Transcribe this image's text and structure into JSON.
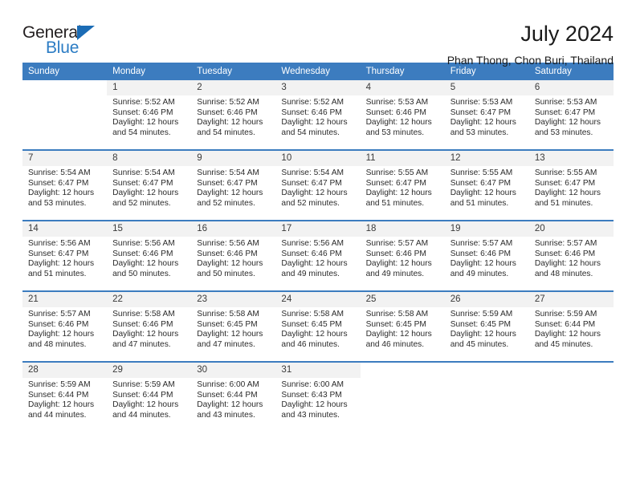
{
  "brand": {
    "name_part1": "General",
    "name_part2": "Blue",
    "triangle_color": "#1b6cb5",
    "blue_color": "#2b7cc4"
  },
  "header": {
    "title": "July 2024",
    "subtitle": "Phan Thong, Chon Buri, Thailand"
  },
  "theme": {
    "header_row_bg": "#3c7cbf",
    "daynum_bg": "#f2f2f2",
    "text_color": "#2b2b2b"
  },
  "calendar": {
    "weekday_headers": [
      "Sunday",
      "Monday",
      "Tuesday",
      "Wednesday",
      "Thursday",
      "Friday",
      "Saturday"
    ],
    "weeks": [
      [
        {
          "day": ""
        },
        {
          "day": "1",
          "sunrise": "Sunrise: 5:52 AM",
          "sunset": "Sunset: 6:46 PM",
          "daylight": "Daylight: 12 hours and 54 minutes."
        },
        {
          "day": "2",
          "sunrise": "Sunrise: 5:52 AM",
          "sunset": "Sunset: 6:46 PM",
          "daylight": "Daylight: 12 hours and 54 minutes."
        },
        {
          "day": "3",
          "sunrise": "Sunrise: 5:52 AM",
          "sunset": "Sunset: 6:46 PM",
          "daylight": "Daylight: 12 hours and 54 minutes."
        },
        {
          "day": "4",
          "sunrise": "Sunrise: 5:53 AM",
          "sunset": "Sunset: 6:46 PM",
          "daylight": "Daylight: 12 hours and 53 minutes."
        },
        {
          "day": "5",
          "sunrise": "Sunrise: 5:53 AM",
          "sunset": "Sunset: 6:47 PM",
          "daylight": "Daylight: 12 hours and 53 minutes."
        },
        {
          "day": "6",
          "sunrise": "Sunrise: 5:53 AM",
          "sunset": "Sunset: 6:47 PM",
          "daylight": "Daylight: 12 hours and 53 minutes."
        }
      ],
      [
        {
          "day": "7",
          "sunrise": "Sunrise: 5:54 AM",
          "sunset": "Sunset: 6:47 PM",
          "daylight": "Daylight: 12 hours and 53 minutes."
        },
        {
          "day": "8",
          "sunrise": "Sunrise: 5:54 AM",
          "sunset": "Sunset: 6:47 PM",
          "daylight": "Daylight: 12 hours and 52 minutes."
        },
        {
          "day": "9",
          "sunrise": "Sunrise: 5:54 AM",
          "sunset": "Sunset: 6:47 PM",
          "daylight": "Daylight: 12 hours and 52 minutes."
        },
        {
          "day": "10",
          "sunrise": "Sunrise: 5:54 AM",
          "sunset": "Sunset: 6:47 PM",
          "daylight": "Daylight: 12 hours and 52 minutes."
        },
        {
          "day": "11",
          "sunrise": "Sunrise: 5:55 AM",
          "sunset": "Sunset: 6:47 PM",
          "daylight": "Daylight: 12 hours and 51 minutes."
        },
        {
          "day": "12",
          "sunrise": "Sunrise: 5:55 AM",
          "sunset": "Sunset: 6:47 PM",
          "daylight": "Daylight: 12 hours and 51 minutes."
        },
        {
          "day": "13",
          "sunrise": "Sunrise: 5:55 AM",
          "sunset": "Sunset: 6:47 PM",
          "daylight": "Daylight: 12 hours and 51 minutes."
        }
      ],
      [
        {
          "day": "14",
          "sunrise": "Sunrise: 5:56 AM",
          "sunset": "Sunset: 6:47 PM",
          "daylight": "Daylight: 12 hours and 51 minutes."
        },
        {
          "day": "15",
          "sunrise": "Sunrise: 5:56 AM",
          "sunset": "Sunset: 6:46 PM",
          "daylight": "Daylight: 12 hours and 50 minutes."
        },
        {
          "day": "16",
          "sunrise": "Sunrise: 5:56 AM",
          "sunset": "Sunset: 6:46 PM",
          "daylight": "Daylight: 12 hours and 50 minutes."
        },
        {
          "day": "17",
          "sunrise": "Sunrise: 5:56 AM",
          "sunset": "Sunset: 6:46 PM",
          "daylight": "Daylight: 12 hours and 49 minutes."
        },
        {
          "day": "18",
          "sunrise": "Sunrise: 5:57 AM",
          "sunset": "Sunset: 6:46 PM",
          "daylight": "Daylight: 12 hours and 49 minutes."
        },
        {
          "day": "19",
          "sunrise": "Sunrise: 5:57 AM",
          "sunset": "Sunset: 6:46 PM",
          "daylight": "Daylight: 12 hours and 49 minutes."
        },
        {
          "day": "20",
          "sunrise": "Sunrise: 5:57 AM",
          "sunset": "Sunset: 6:46 PM",
          "daylight": "Daylight: 12 hours and 48 minutes."
        }
      ],
      [
        {
          "day": "21",
          "sunrise": "Sunrise: 5:57 AM",
          "sunset": "Sunset: 6:46 PM",
          "daylight": "Daylight: 12 hours and 48 minutes."
        },
        {
          "day": "22",
          "sunrise": "Sunrise: 5:58 AM",
          "sunset": "Sunset: 6:46 PM",
          "daylight": "Daylight: 12 hours and 47 minutes."
        },
        {
          "day": "23",
          "sunrise": "Sunrise: 5:58 AM",
          "sunset": "Sunset: 6:45 PM",
          "daylight": "Daylight: 12 hours and 47 minutes."
        },
        {
          "day": "24",
          "sunrise": "Sunrise: 5:58 AM",
          "sunset": "Sunset: 6:45 PM",
          "daylight": "Daylight: 12 hours and 46 minutes."
        },
        {
          "day": "25",
          "sunrise": "Sunrise: 5:58 AM",
          "sunset": "Sunset: 6:45 PM",
          "daylight": "Daylight: 12 hours and 46 minutes."
        },
        {
          "day": "26",
          "sunrise": "Sunrise: 5:59 AM",
          "sunset": "Sunset: 6:45 PM",
          "daylight": "Daylight: 12 hours and 45 minutes."
        },
        {
          "day": "27",
          "sunrise": "Sunrise: 5:59 AM",
          "sunset": "Sunset: 6:44 PM",
          "daylight": "Daylight: 12 hours and 45 minutes."
        }
      ],
      [
        {
          "day": "28",
          "sunrise": "Sunrise: 5:59 AM",
          "sunset": "Sunset: 6:44 PM",
          "daylight": "Daylight: 12 hours and 44 minutes."
        },
        {
          "day": "29",
          "sunrise": "Sunrise: 5:59 AM",
          "sunset": "Sunset: 6:44 PM",
          "daylight": "Daylight: 12 hours and 44 minutes."
        },
        {
          "day": "30",
          "sunrise": "Sunrise: 6:00 AM",
          "sunset": "Sunset: 6:44 PM",
          "daylight": "Daylight: 12 hours and 43 minutes."
        },
        {
          "day": "31",
          "sunrise": "Sunrise: 6:00 AM",
          "sunset": "Sunset: 6:43 PM",
          "daylight": "Daylight: 12 hours and 43 minutes."
        },
        {
          "day": ""
        },
        {
          "day": ""
        },
        {
          "day": ""
        }
      ]
    ]
  }
}
